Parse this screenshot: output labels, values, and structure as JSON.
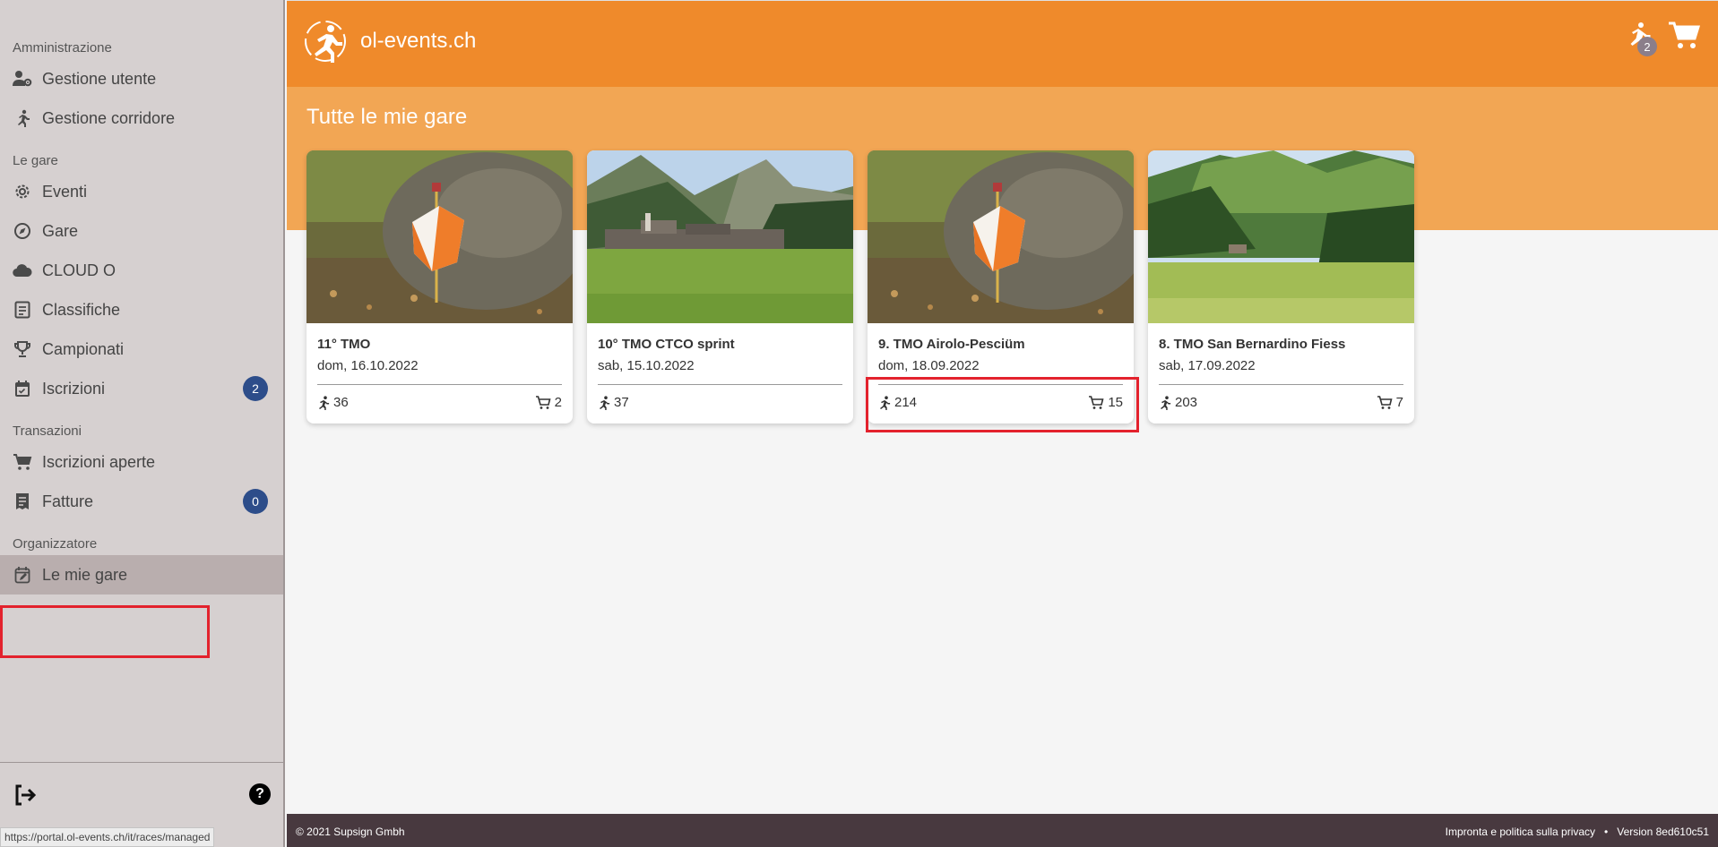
{
  "sidebar": {
    "sections": {
      "admin": "Amministrazione",
      "races": "Le gare",
      "transactions": "Transazioni",
      "organizer": "Organizzatore"
    },
    "items": {
      "user_management": "Gestione utente",
      "runner_management": "Gestione corridore",
      "events": "Eventi",
      "races": "Gare",
      "cloud_o": "CLOUD O",
      "rankings": "Classifiche",
      "championships": "Campionati",
      "registrations": "Iscrizioni",
      "registrations_badge": "2",
      "open_registrations": "Iscrizioni aperte",
      "invoices": "Fatture",
      "invoices_badge": "0",
      "my_races": "Le mie gare"
    },
    "help_label": "?",
    "status_url": "https://portal.ol-events.ch/it/races/managed"
  },
  "header": {
    "brand": "ol-events.ch",
    "runner_count": "2"
  },
  "main": {
    "title": "Tutte le mie gare",
    "cards": [
      {
        "title": "11° TMO",
        "date": "dom, 16.10.2022",
        "runners": "36",
        "orders": "2"
      },
      {
        "title": "10° TMO CTCO sprint",
        "date": "sab, 15.10.2022",
        "runners": "37",
        "orders": ""
      },
      {
        "title": "9. TMO Airolo-Pesciüm",
        "date": "dom, 18.09.2022",
        "runners": "214",
        "orders": "15"
      },
      {
        "title": "8. TMO San Bernardino Fiess",
        "date": "sab, 17.09.2022",
        "runners": "203",
        "orders": "7"
      }
    ]
  },
  "footer": {
    "copyright": "© 2021 Supsign Gmbh",
    "privacy": "Impronta e politica sulla privacy",
    "separator": "•",
    "version": "Version 8ed610c51"
  },
  "colors": {
    "brand_orange": "#ef8a2b",
    "band_orange": "#f2a654",
    "badge_blue": "#2d4d8a",
    "highlight_red": "#e3222d",
    "footer_bg": "#48393f"
  }
}
